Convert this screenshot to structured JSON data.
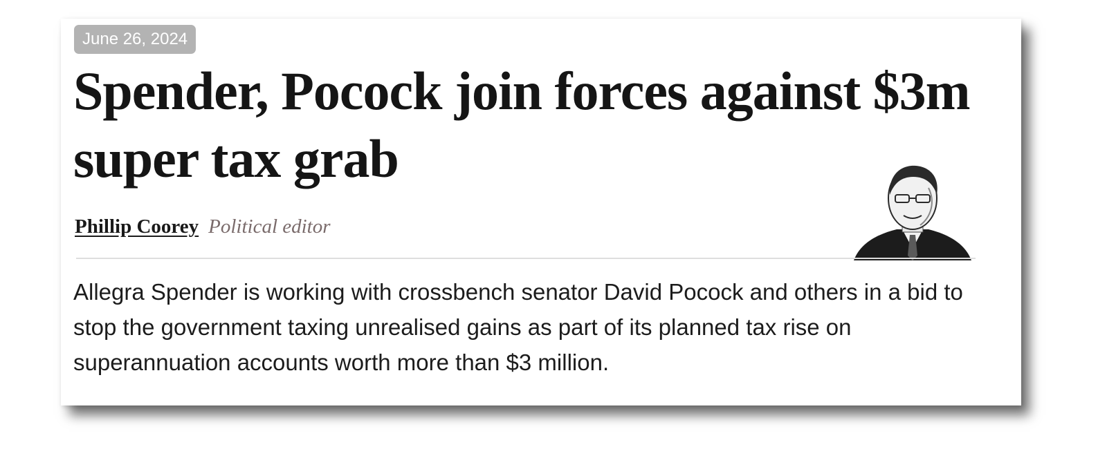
{
  "article": {
    "date": "June 26, 2024",
    "headline": "Spender, Pocock join forces against $3m super tax grab",
    "author_name": "Phillip Coorey",
    "author_role": "Political editor",
    "summary": "Allegra Spender is working with crossbench senator David Pocock and others in a bid to stop the government taxing unrealised gains as part of its planned tax rise on superannuation accounts worth more than $3 million."
  },
  "icons": {
    "author_photo": "author-portrait-icon"
  }
}
